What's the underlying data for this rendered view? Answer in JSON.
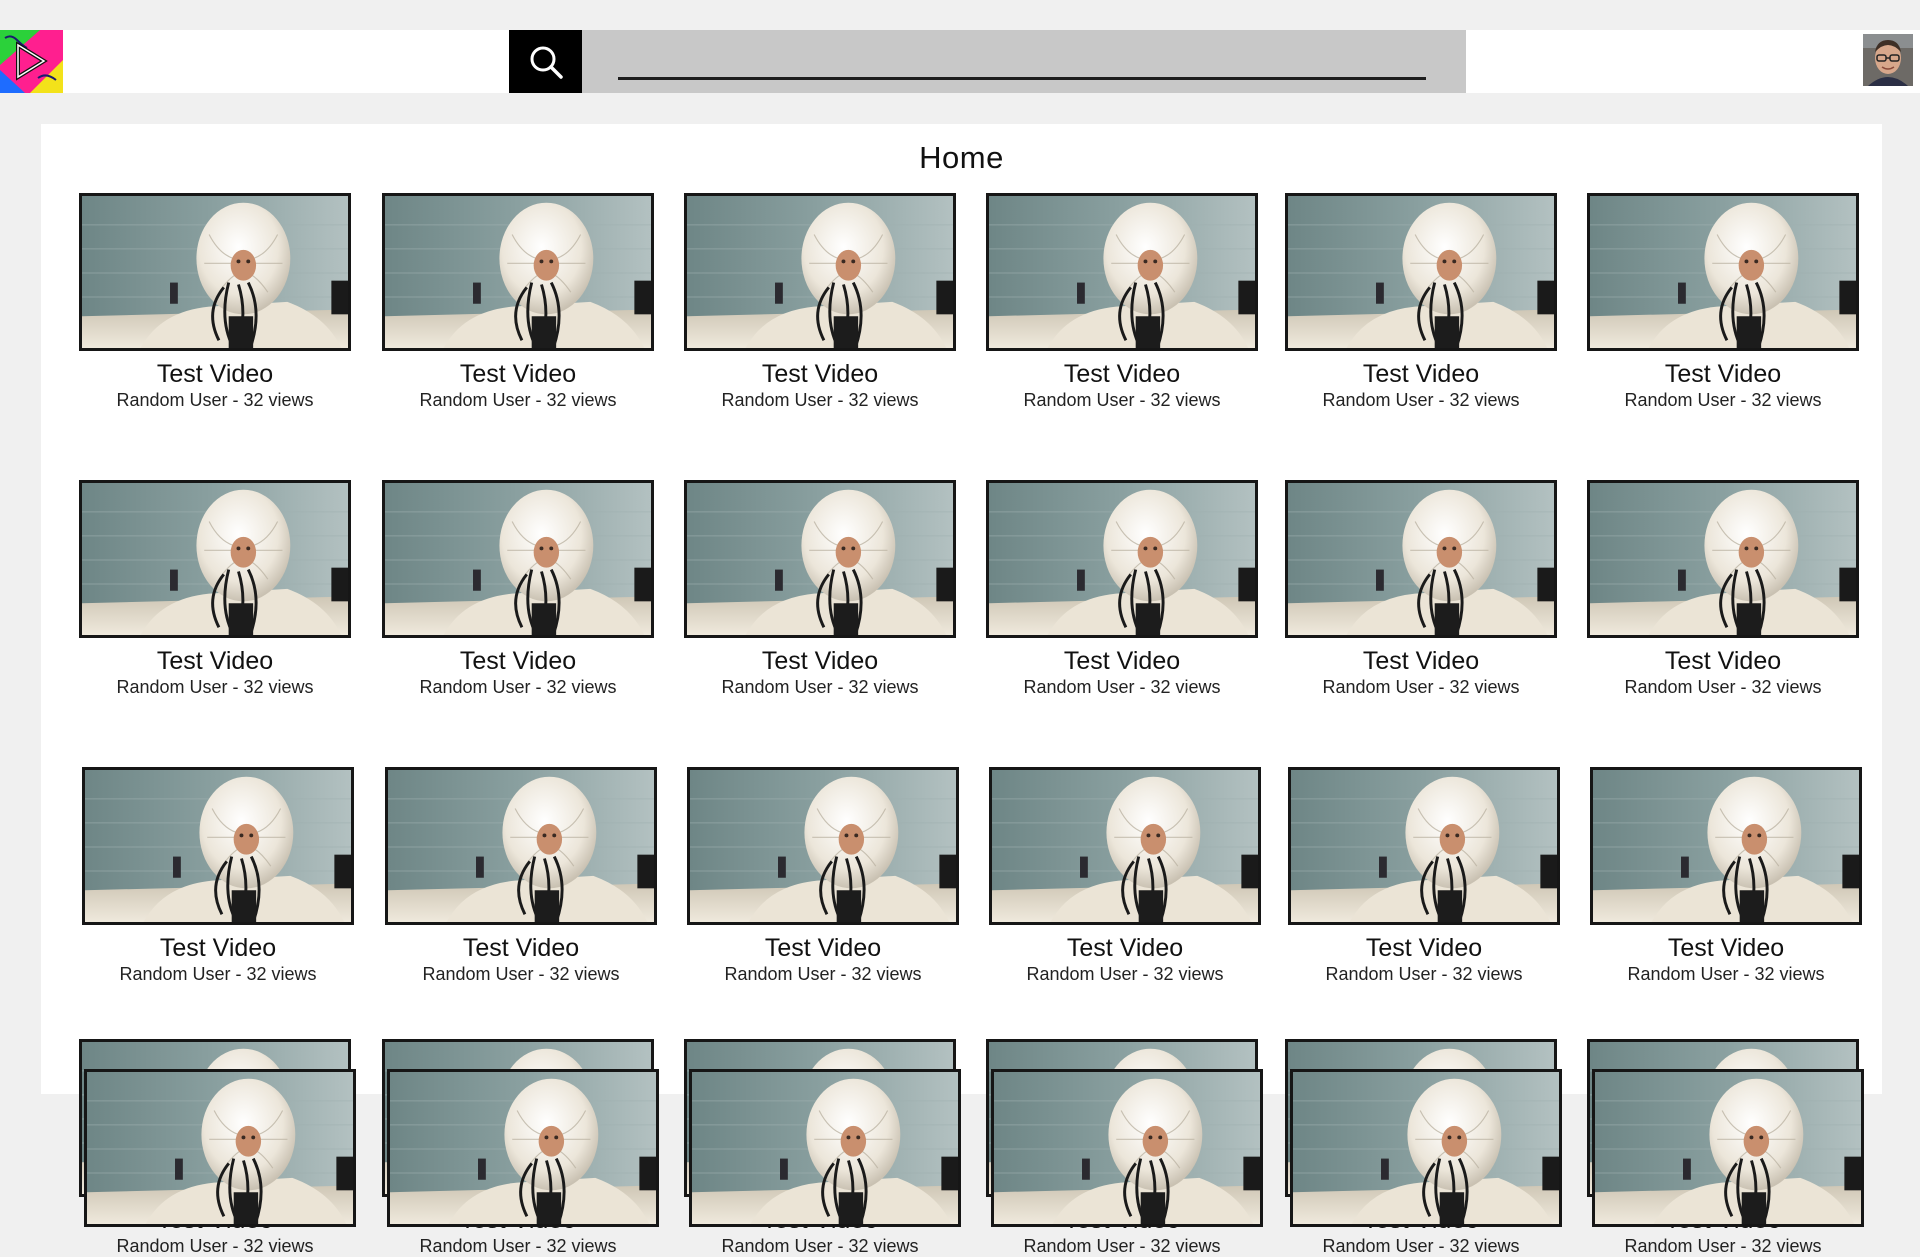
{
  "header": {
    "logo_name": "app-logo-icon",
    "search_icon": "search-icon",
    "search": {
      "value": "",
      "placeholder": ""
    },
    "avatar_name": "user-avatar"
  },
  "main": {
    "title": "Home",
    "videos": [
      {
        "title": "Test Video",
        "meta": "Random User - 32 views"
      },
      {
        "title": "Test Video",
        "meta": "Random User - 32 views"
      },
      {
        "title": "Test Video",
        "meta": "Random User - 32 views"
      },
      {
        "title": "Test Video",
        "meta": "Random User - 32 views"
      },
      {
        "title": "Test Video",
        "meta": "Random User - 32 views"
      },
      {
        "title": "Test Video",
        "meta": "Random User - 32 views"
      },
      {
        "title": "Test Video",
        "meta": "Random User - 32 views"
      },
      {
        "title": "Test Video",
        "meta": "Random User - 32 views"
      },
      {
        "title": "Test Video",
        "meta": "Random User - 32 views"
      },
      {
        "title": "Test Video",
        "meta": "Random User - 32 views"
      },
      {
        "title": "Test Video",
        "meta": "Random User - 32 views"
      },
      {
        "title": "Test Video",
        "meta": "Random User - 32 views"
      },
      {
        "title": "Test Video",
        "meta": "Random User - 32 views"
      },
      {
        "title": "Test Video",
        "meta": "Random User - 32 views"
      },
      {
        "title": "Test Video",
        "meta": "Random User - 32 views"
      },
      {
        "title": "Test Video",
        "meta": "Random User - 32 views"
      },
      {
        "title": "Test Video",
        "meta": "Random User - 32 views"
      },
      {
        "title": "Test Video",
        "meta": "Random User - 32 views"
      },
      {
        "title": "Test Video",
        "meta": "Random User - 32 views"
      },
      {
        "title": "Test Video",
        "meta": "Random User - 32 views"
      },
      {
        "title": "Test Video",
        "meta": "Random User - 32 views"
      },
      {
        "title": "Test Video",
        "meta": "Random User - 32 views"
      },
      {
        "title": "Test Video",
        "meta": "Random User - 32 views"
      },
      {
        "title": "Test Video",
        "meta": "Random User - 32 views"
      }
    ]
  },
  "colors": {
    "background": "#f0f0f0",
    "panel": "#ffffff",
    "search_button": "#000000",
    "search_box": "#c8c8c8"
  }
}
